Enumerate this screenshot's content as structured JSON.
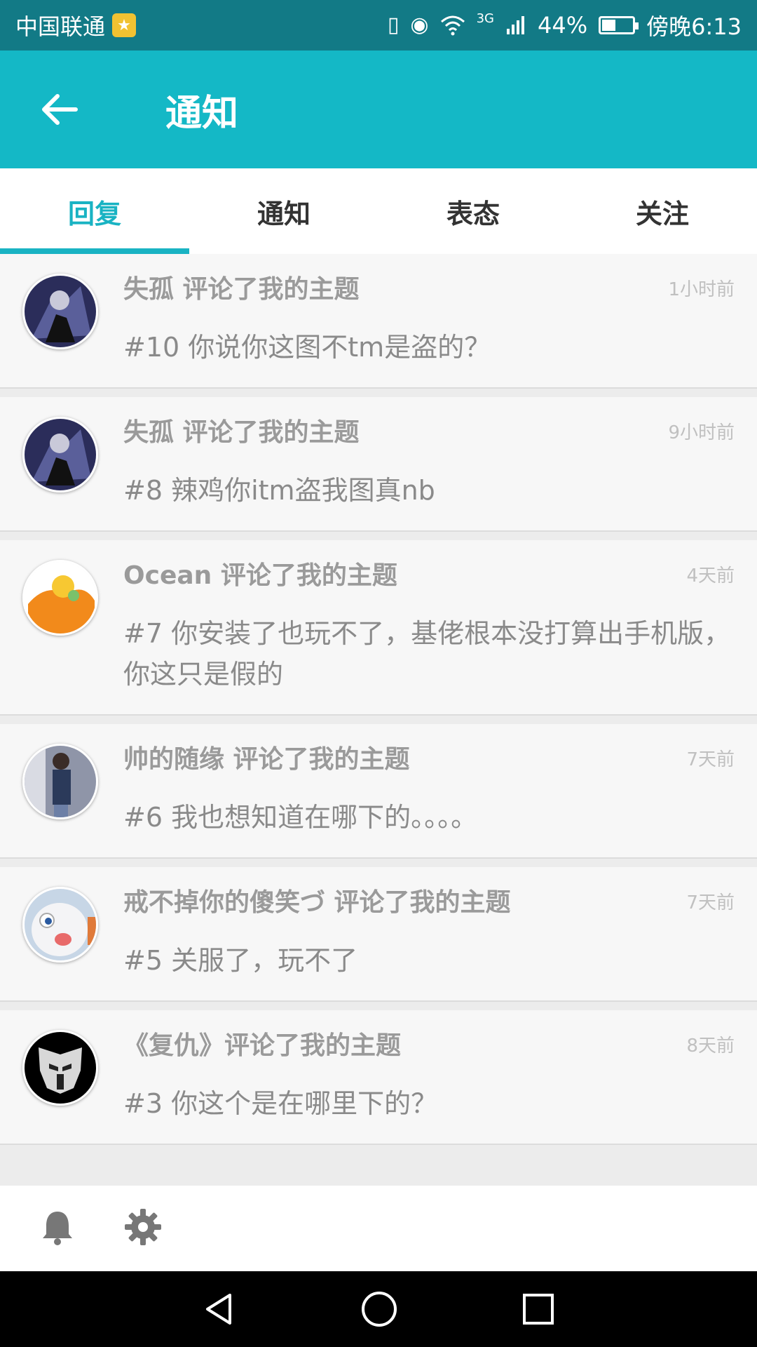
{
  "status_bar": {
    "carrier": "中国联通",
    "network": "3G",
    "battery_text": "44%",
    "battery_level": 0.44,
    "time": "傍晚6:13"
  },
  "app_bar": {
    "title": "通知",
    "back_icon": "back-arrow-icon"
  },
  "tabs": [
    {
      "label": "回复",
      "active": true
    },
    {
      "label": "通知",
      "active": false
    },
    {
      "label": "表态",
      "active": false
    },
    {
      "label": "关注",
      "active": false
    }
  ],
  "notifications": [
    {
      "title": "失孤 评论了我的主题",
      "time": "1小时前",
      "body": "#10 你说你这图不tm是盗的？",
      "avatar": "avatar-dark-figure"
    },
    {
      "title": "失孤 评论了我的主题",
      "time": "9小时前",
      "body": "#8 辣鸡你itm盗我图真nb",
      "avatar": "avatar-dark-figure"
    },
    {
      "title": "Ocean 评论了我的主题",
      "time": "4天前",
      "body": "#7 你安装了也玩不了，基佬根本没打算出手机版，你这只是假的",
      "avatar": "avatar-orange-character"
    },
    {
      "title": "帅的随缘 评论了我的主题",
      "time": "7天前",
      "body": "#6 我也想知道在哪下的。。。。",
      "avatar": "avatar-photo-person"
    },
    {
      "title": "戒不掉你的傻笑づ 评论了我的主题",
      "time": "7天前",
      "body": "#5 关服了，玩不了",
      "avatar": "avatar-white-rabbit"
    },
    {
      "title": "《复仇》评论了我的主题",
      "time": "8天前",
      "body": "#3 你这个是在哪里下的？",
      "avatar": "avatar-autobot-logo"
    }
  ],
  "bottom_bar": {
    "icons": [
      "bell-icon",
      "gear-icon"
    ]
  },
  "nav_bar": {
    "icons": [
      "back-triangle-icon",
      "home-circle-icon",
      "recents-square-icon"
    ]
  },
  "colors": {
    "accent": "#14b8c6",
    "status_bar": "#127a86",
    "tab_active": "#19b3c3"
  }
}
